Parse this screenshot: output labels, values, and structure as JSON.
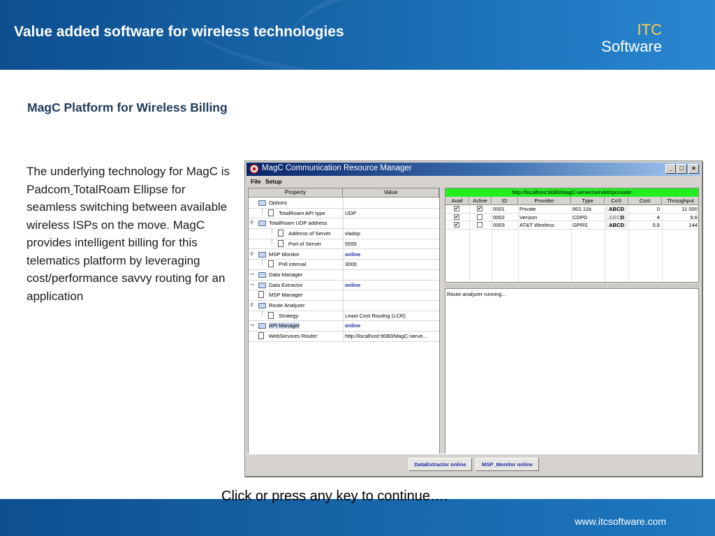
{
  "slide": {
    "title": "Value added software for wireless technologies",
    "logo_top": "ITC",
    "logo_bottom": "Software",
    "subtitle": "MagC Platform for Wireless Billing",
    "body_before": "The underlying technology for MagC is Padcom",
    "body_underlined": " ",
    "body_after": "TotalRoam Ellipse for seamless switching between available wireless ISPs on the move. MagC provides intelligent billing for this telematics platform by leveraging cost/performance savvy routing for an application",
    "continue": "Click or press any key to continue….",
    "footer_url": "www.itcsoftware.com"
  },
  "window": {
    "title": "MagC Communication Resource Manager",
    "min_glyph": "_",
    "max_glyph": "□",
    "close_glyph": "×",
    "menu": {
      "file": "File",
      "setup": "Setup"
    },
    "properties": {
      "headers": {
        "property": "Property",
        "value": "Value"
      },
      "rows": [
        {
          "key": "Options",
          "value": ""
        },
        {
          "key": "TotalRoam API type",
          "value": "UDP"
        },
        {
          "key": "TotalRoam UDP address",
          "value": ""
        },
        {
          "key": "Address of Server",
          "value": "vladxp"
        },
        {
          "key": "Port of Server",
          "value": "5555"
        },
        {
          "key": "MSP Monitor",
          "value": "online"
        },
        {
          "key": "Poll interval",
          "value": "3000"
        },
        {
          "key": "Data Manager",
          "value": ""
        },
        {
          "key": "Data Extractor",
          "value": "online"
        },
        {
          "key": "MSP Manager",
          "value": ""
        },
        {
          "key": "Route Analyzer",
          "value": ""
        },
        {
          "key": "Strategy",
          "value": "Least Cost Routing (LCR)"
        },
        {
          "key": "API Manager",
          "value": "online"
        },
        {
          "key": "WebServices Router",
          "value": "http://localhost:9080/MagC-serve..."
        }
      ]
    },
    "routes": {
      "servlet_url": "http://localhost:9080/MagC-server/servlet/rpcrouter",
      "headers": [
        "Avail",
        "Active",
        "ID",
        "Provider",
        "Type",
        "CoS",
        "Cost",
        "Throughput"
      ],
      "check_glyph": "✔",
      "rows": [
        {
          "avail": true,
          "active": true,
          "id": "0001",
          "provider": "Private",
          "type": "802.11b",
          "cos": "ABCD",
          "cos_dim": "",
          "cos_bold_tail": "",
          "cost": "0",
          "throughput": "11 000"
        },
        {
          "avail": true,
          "active": false,
          "id": "0002",
          "provider": "Verizon",
          "type": "CDPD",
          "cos": "",
          "cos_dim": "ABC",
          "cos_bold_tail": "D",
          "cost": "4",
          "throughput": "9,6"
        },
        {
          "avail": true,
          "active": false,
          "id": "0003",
          "provider": "AT&T Wireless",
          "type": "GPRS",
          "cos": "ABCD",
          "cos_dim": "",
          "cos_bold_tail": "",
          "cost": "0,8",
          "throughput": "144"
        }
      ]
    },
    "log": "Route analyzer running...",
    "status": {
      "extractor": "DataExtractor online",
      "monitor": "MSP_Monitor online"
    }
  },
  "colors": {
    "header_blue": "#1765a8",
    "logo_yellow": "#ffd24a",
    "status_blue": "#1d2ea8",
    "servlet_green": "#22ee22"
  }
}
